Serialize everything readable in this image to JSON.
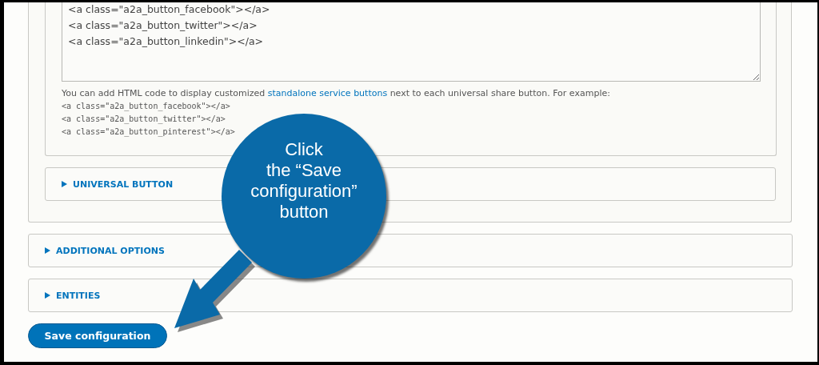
{
  "share_buttons_field": {
    "value_lines": [
      "<a class=\"a2a_button_facebook\"></a>",
      "<a class=\"a2a_button_twitter\"></a>",
      "<a class=\"a2a_button_linkedin\"></a>"
    ],
    "help_before": "You can add HTML code to display customized ",
    "help_link": "standalone service buttons",
    "help_after": " next to each universal share button. For example:",
    "example_lines": [
      "<a class=\"a2a_button_facebook\"></a>",
      "<a class=\"a2a_button_twitter\"></a>",
      "<a class=\"a2a_button_pinterest\"></a>"
    ]
  },
  "inner_sections": [
    {
      "label": "UNIVERSAL BUTTON",
      "expanded": false
    }
  ],
  "sections": [
    {
      "label": "ADDITIONAL OPTIONS",
      "expanded": false
    },
    {
      "label": "ENTITIES",
      "expanded": false
    }
  ],
  "save_button": "Save configuration",
  "callout": {
    "lines": [
      "Click",
      "the “Save",
      "configuration”",
      "button"
    ]
  }
}
